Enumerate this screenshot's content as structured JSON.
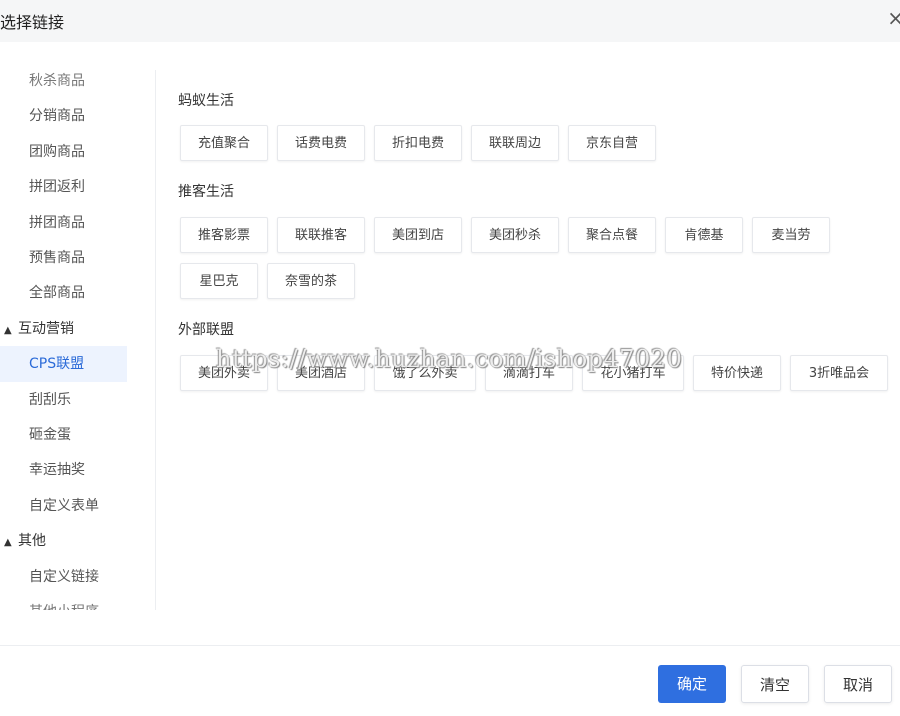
{
  "dialog": {
    "title": "选择链接",
    "close_glyph": "×"
  },
  "sidebar": {
    "items": [
      {
        "label": "秋杀商品",
        "kind": "item"
      },
      {
        "label": "分销商品",
        "kind": "item"
      },
      {
        "label": "团购商品",
        "kind": "item"
      },
      {
        "label": "拼团返利",
        "kind": "item"
      },
      {
        "label": "拼团商品",
        "kind": "item"
      },
      {
        "label": "预售商品",
        "kind": "item"
      },
      {
        "label": "全部商品",
        "kind": "item"
      },
      {
        "label": "互动营销",
        "kind": "group"
      },
      {
        "label": "CPS联盟",
        "kind": "item",
        "active": true
      },
      {
        "label": "刮刮乐",
        "kind": "item"
      },
      {
        "label": "砸金蛋",
        "kind": "item"
      },
      {
        "label": "幸运抽奖",
        "kind": "item"
      },
      {
        "label": "自定义表单",
        "kind": "item"
      },
      {
        "label": "其他",
        "kind": "group"
      },
      {
        "label": "自定义链接",
        "kind": "item"
      },
      {
        "label": "其他小程序",
        "kind": "item"
      }
    ],
    "group_icon": "▲"
  },
  "sections": [
    {
      "title": "蚂蚁生活",
      "tags": [
        "充值聚合",
        "话费电费",
        "折扣电费",
        "联联周边",
        "京东自营"
      ]
    },
    {
      "title": "推客生活",
      "tags": [
        "推客影票",
        "联联推客",
        "美团到店",
        "美团秒杀",
        "聚合点餐",
        "肯德基",
        "麦当劳",
        "星巴克",
        "奈雪的茶"
      ]
    },
    {
      "title": "外部联盟",
      "tags": [
        "美团外卖",
        "美团酒店",
        "饿了么外卖",
        "滴滴打车",
        "花小猪打车",
        "特价快递",
        "3折唯品会"
      ]
    }
  ],
  "watermark": "https://www.huzhan.com/ishop47020",
  "footer": {
    "confirm": "确定",
    "clear": "清空",
    "cancel": "取消"
  },
  "colors": {
    "primary": "#2f6fe0",
    "active_bg": "#edf3fe",
    "active_text": "#2c6bd8"
  }
}
